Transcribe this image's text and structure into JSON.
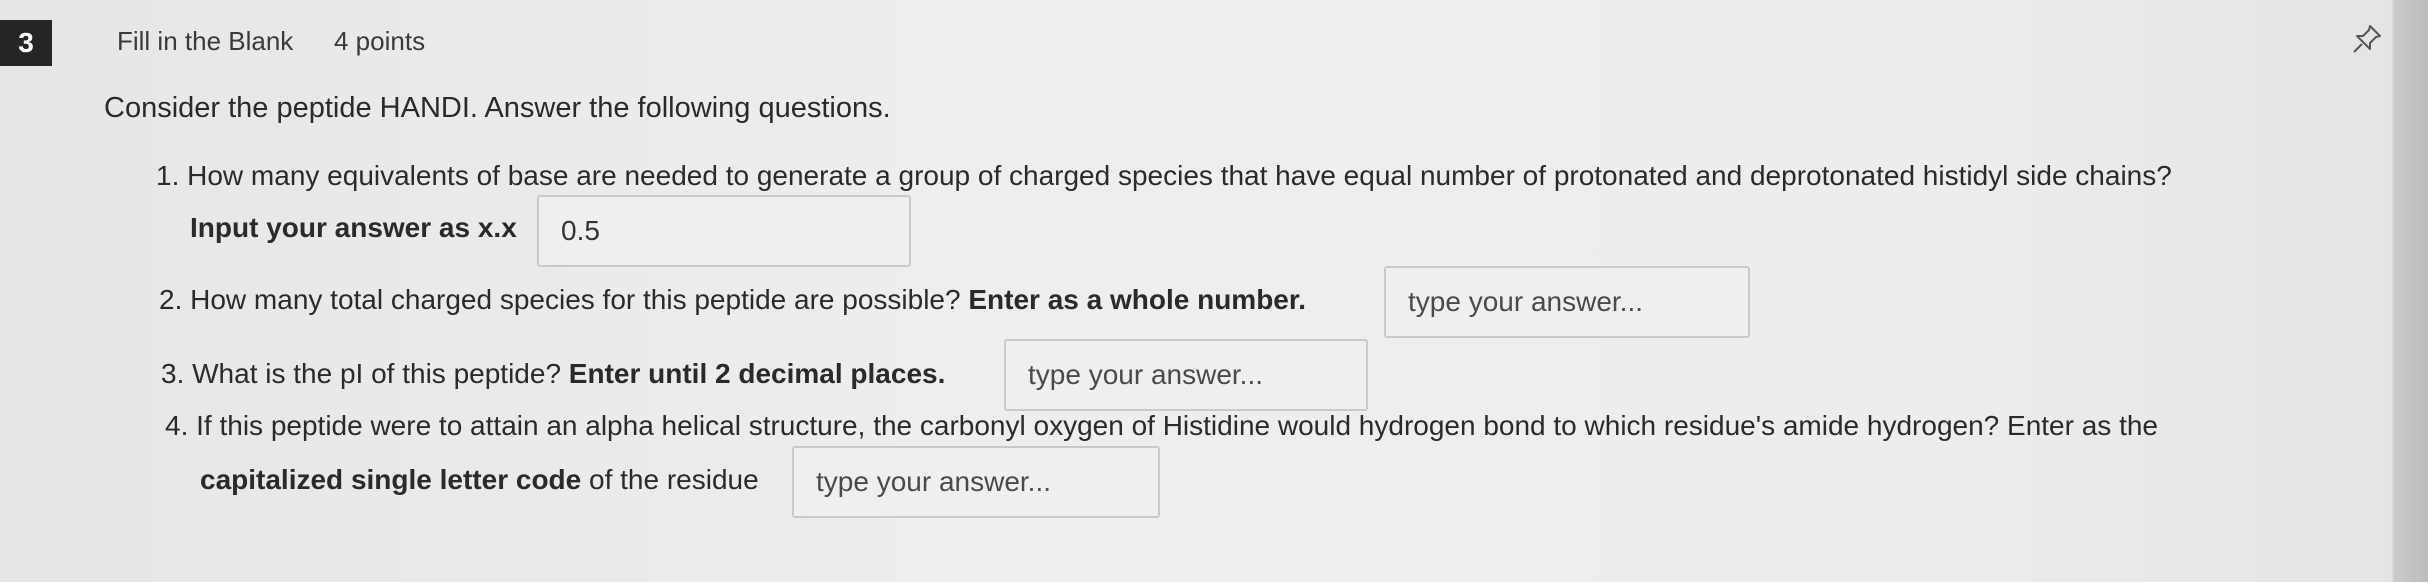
{
  "question": {
    "number": "3",
    "type": "Fill in the Blank",
    "points": "4 points",
    "prompt": "Consider the peptide HANDI. Answer the following questions."
  },
  "items": [
    {
      "text_a": "1. How many equivalents of base are needed to generate a group of charged species that have equal number of protonated and deprotonated histidyl side chains?",
      "text_b": "Input your answer as x.x",
      "value": "0.5",
      "placeholder": ""
    },
    {
      "text_a": "2. How many total charged species for this peptide are possible?",
      "text_b": "Enter as a whole number.",
      "value": "",
      "placeholder": "type your answer..."
    },
    {
      "text_a": "3. What is the pI of this peptide?",
      "text_b": "Enter until 2 decimal places.",
      "value": "",
      "placeholder": "type your answer..."
    },
    {
      "text_a": "4. If this peptide were to attain an alpha helical structure, the carbonyl oxygen of Histidine would hydrogen bond to which residue's amide hydrogen? Enter as the",
      "text_b": "capitalized single letter code",
      "text_c": "of the residue",
      "value": "",
      "placeholder": "type your answer..."
    }
  ],
  "icons": {
    "pin": "pin-icon"
  }
}
